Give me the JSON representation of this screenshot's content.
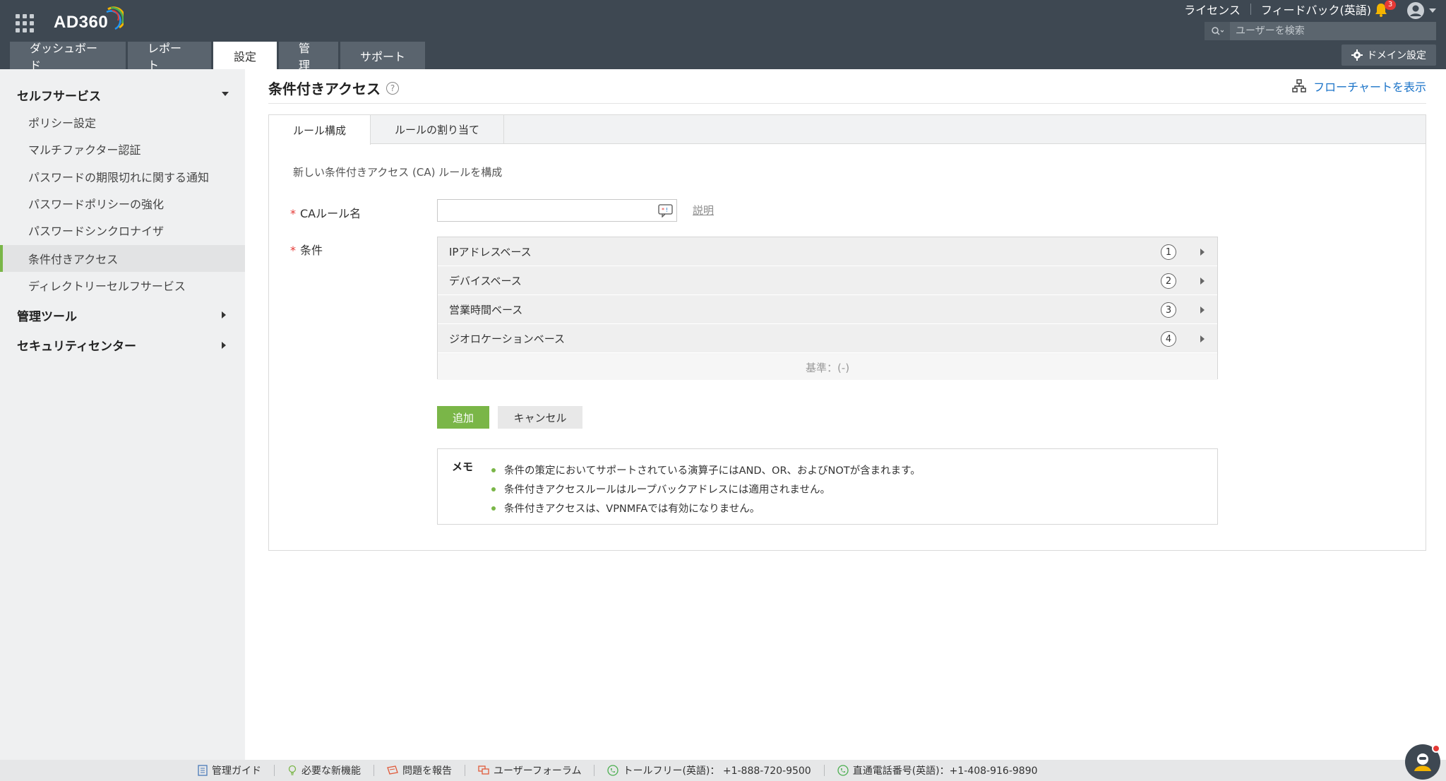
{
  "header": {
    "logo": "AD360",
    "links": [
      "ライセンス",
      "フィードバック(英語)"
    ],
    "notification_count": "3",
    "search_placeholder": "ユーザーを検索",
    "tabs": [
      "ダッシュボード",
      "レポート",
      "設定",
      "管理",
      "サポート"
    ],
    "active_tab": "設定",
    "domain_button": "ドメイン設定"
  },
  "sidebar": {
    "section_selfservice": "セルフサービス",
    "items": [
      "ポリシー設定",
      "マルチファクター認証",
      "パスワードの期限切れに関する通知",
      "パスワードポリシーの強化",
      "パスワードシンクロナイザ",
      "条件付きアクセス",
      "ディレクトリーセルフサービス"
    ],
    "active_item": "条件付きアクセス",
    "section_admin_tools": "管理ツール",
    "section_security_center": "セキュリティセンター"
  },
  "main": {
    "title": "条件付きアクセス",
    "flowchart_link": "フローチャートを表示",
    "tabs": [
      "ルール構成",
      "ルールの割り当て"
    ],
    "form_heading": "新しい条件付きアクセス (CA) ルールを構成",
    "ca_rule_label": "CAルール名",
    "ca_rule_value": "",
    "description_link": "説明",
    "conditions_label": "条件",
    "conditions": [
      {
        "label": "IPアドレスベース",
        "num": "1"
      },
      {
        "label": "デバイスベース",
        "num": "2"
      },
      {
        "label": "営業時間ベース",
        "num": "3"
      },
      {
        "label": "ジオロケーションベース",
        "num": "4"
      }
    ],
    "criteria_text": "基準：(-)",
    "add_button": "追加",
    "cancel_button": "キャンセル",
    "memo_label": "メモ",
    "memo_items": [
      "条件の策定においてサポートされている演算子にはAND、OR、およびNOTが含まれます。",
      "条件付きアクセスルールはループバックアドレスには適用されません。",
      "条件付きアクセスは、VPNMFAでは有効になりません。"
    ]
  },
  "footer": {
    "items": [
      "管理ガイド",
      "必要な新機能",
      "問題を報告",
      "ユーザーフォーラム",
      "トールフリー(英語)： +1-888-720-9500",
      "直通電話番号(英語)：+1-408-916-9890"
    ]
  },
  "colors": {
    "header_bg": "#3e4852",
    "accent_green": "#7ab648",
    "link_blue": "#1a73c8",
    "badge_red": "#e53935"
  }
}
